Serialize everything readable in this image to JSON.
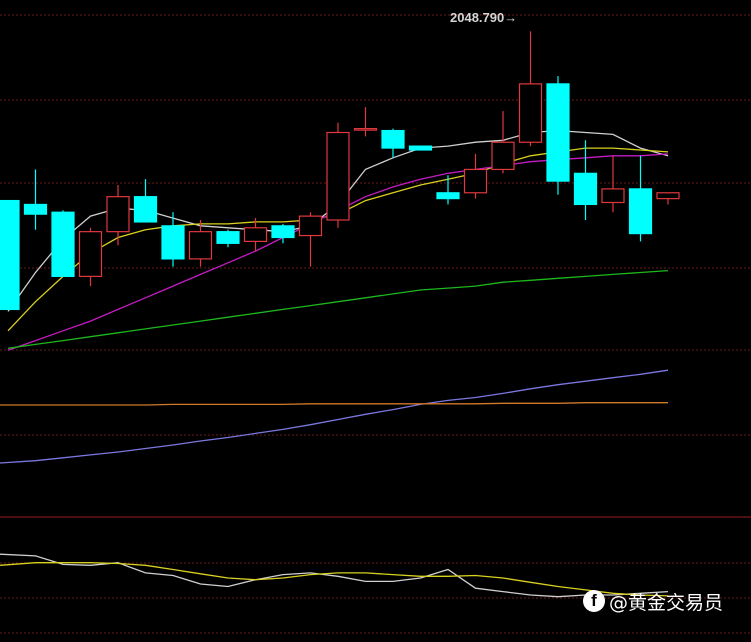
{
  "chart_data": {
    "type": "candlestick",
    "price_range": [
      1880,
      2060
    ],
    "peak_annotation": {
      "value": "2048.790",
      "arrow": "→"
    },
    "colors": {
      "background": "#000000",
      "bullish": "#e0383e",
      "bearish": "#00ffff",
      "grid": "#6a1a1a",
      "ma_white": "#cfcfcf",
      "ma_yellow": "#d9d020",
      "ma_magenta": "#c51bc4",
      "ma_green": "#1db81d",
      "ind_blue": "#7a78e0",
      "ind_orange": "#d07a2a"
    },
    "candles": [
      {
        "o": 1962,
        "h": 1962,
        "l": 1906,
        "c": 1906
      },
      {
        "o": 1960,
        "h": 1978,
        "l": 1947,
        "c": 1955
      },
      {
        "o": 1956,
        "h": 1957,
        "l": 1923,
        "c": 1923
      },
      {
        "o": 1923,
        "h": 1948,
        "l": 1918,
        "c": 1946
      },
      {
        "o": 1946,
        "h": 1970,
        "l": 1939,
        "c": 1964
      },
      {
        "o": 1964,
        "h": 1973,
        "l": 1951,
        "c": 1951
      },
      {
        "o": 1949,
        "h": 1956,
        "l": 1928,
        "c": 1932
      },
      {
        "o": 1932,
        "h": 1952,
        "l": 1928,
        "c": 1946
      },
      {
        "o": 1946,
        "h": 1947,
        "l": 1938,
        "c": 1940
      },
      {
        "o": 1941,
        "h": 1953,
        "l": 1936,
        "c": 1948
      },
      {
        "o": 1949,
        "h": 1950,
        "l": 1940,
        "c": 1943
      },
      {
        "o": 1944,
        "h": 1956,
        "l": 1928,
        "c": 1954
      },
      {
        "o": 1952,
        "h": 2002,
        "l": 1948,
        "c": 1997
      },
      {
        "o": 1999,
        "h": 2010,
        "l": 1995,
        "c": 1999
      },
      {
        "o": 1998,
        "h": 1999,
        "l": 1984,
        "c": 1989
      },
      {
        "o": 1990,
        "h": 1990,
        "l": 1988,
        "c": 1988
      },
      {
        "o": 1966,
        "h": 1975,
        "l": 1960,
        "c": 1963
      },
      {
        "o": 1966,
        "h": 1986,
        "l": 1963,
        "c": 1978
      },
      {
        "o": 1978,
        "h": 2008,
        "l": 1976,
        "c": 1992
      },
      {
        "o": 1992,
        "h": 2049,
        "l": 1990,
        "c": 2022
      },
      {
        "o": 2022,
        "h": 2026,
        "l": 1965,
        "c": 1972
      },
      {
        "o": 1976,
        "h": 1993,
        "l": 1952,
        "c": 1960
      },
      {
        "o": 1961,
        "h": 1985,
        "l": 1956,
        "c": 1968
      },
      {
        "o": 1968,
        "h": 1985,
        "l": 1941,
        "c": 1945
      },
      {
        "o": 1963,
        "h": 1966,
        "l": 1960,
        "c": 1966
      }
    ],
    "ma_series": [
      {
        "values": [
          1905,
          1925,
          1942,
          1954,
          1958,
          1957,
          1953,
          1949,
          1948,
          1947,
          1946,
          1949,
          1960,
          1978,
          1984,
          1989,
          1990,
          1992,
          1993,
          1997,
          1998,
          1997,
          1996,
          1989,
          1985
        ]
      },
      {
        "values": [
          1895,
          1910,
          1923,
          1935,
          1943,
          1947,
          1949,
          1950,
          1950,
          1951,
          1951,
          1952,
          1955,
          1962,
          1966,
          1970,
          1973,
          1976,
          1981,
          1985,
          1987,
          1989,
          1989,
          1988,
          1987
        ]
      },
      {
        "values": [
          1885,
          1890,
          1895,
          1900,
          1906,
          1912,
          1918,
          1924,
          1930,
          1936,
          1943,
          1950,
          1957,
          1964,
          1969,
          1973,
          1976,
          1978,
          1980,
          1982,
          1983,
          1984,
          1985,
          1985,
          1986
        ]
      },
      {
        "values": [
          1886,
          1888,
          1890,
          1892,
          1894,
          1896,
          1898,
          1900,
          1902,
          1904,
          1906,
          1908,
          1910,
          1912,
          1914,
          1916,
          1917,
          1918,
          1920,
          1921,
          1922,
          1923,
          1924,
          1925,
          1926
        ]
      }
    ],
    "indicator_series": [
      {
        "values": [
          0,
          4,
          9,
          14,
          19,
          25,
          31,
          38,
          44,
          51,
          58,
          66,
          75,
          84,
          92,
          101,
          108,
          113,
          120,
          128,
          135,
          141,
          147,
          153,
          160
        ]
      },
      {
        "values": [
          100,
          100,
          100,
          100,
          100,
          100,
          101,
          101,
          101,
          101,
          101,
          102,
          102,
          102,
          102,
          102,
          102,
          102,
          103,
          103,
          103,
          104,
          104,
          104,
          104
        ]
      }
    ],
    "oscillator_series": [
      {
        "values": [
          68,
          66,
          56,
          55,
          58,
          46,
          43,
          33,
          30,
          38,
          44,
          46,
          42,
          36,
          36,
          40,
          50,
          28,
          24,
          20,
          18,
          20,
          20,
          22,
          24
        ]
      },
      {
        "values": [
          55,
          58,
          58,
          58,
          57,
          55,
          50,
          45,
          40,
          38,
          40,
          44,
          46,
          46,
          44,
          42,
          42,
          43,
          40,
          35,
          30,
          26,
          22,
          20,
          19
        ]
      }
    ]
  },
  "watermark": {
    "icon": "f",
    "text": "@黄金交易员"
  }
}
